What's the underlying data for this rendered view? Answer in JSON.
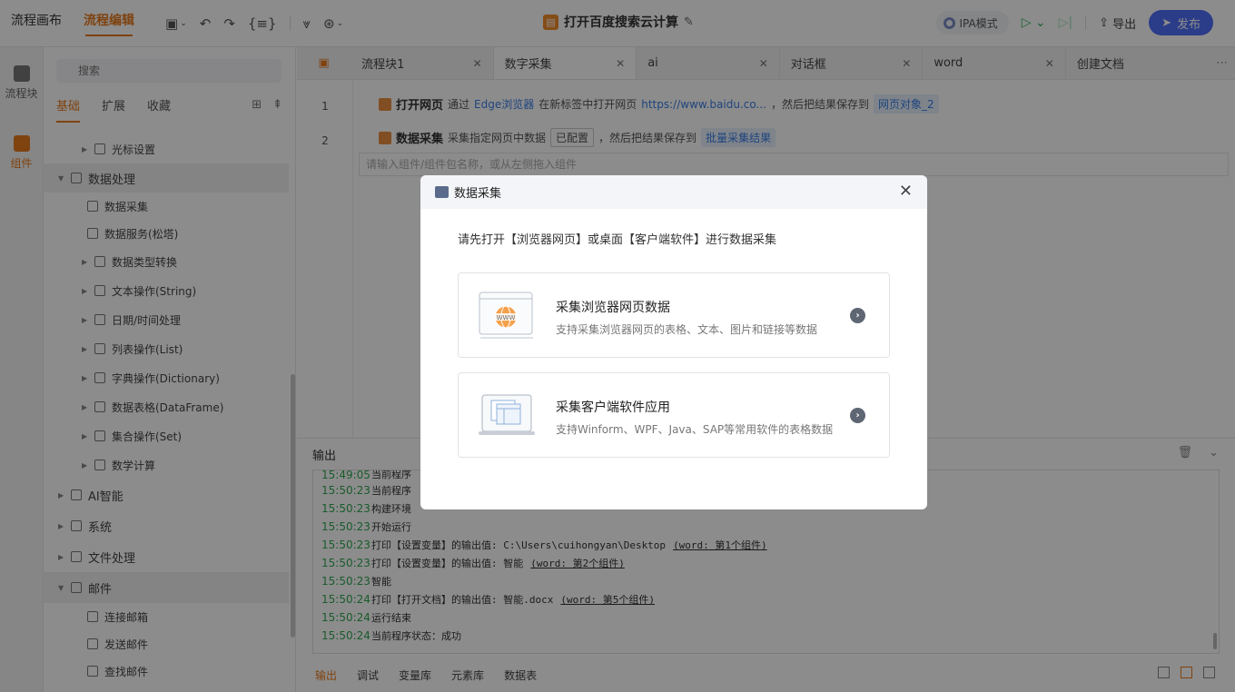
{
  "topbar": {
    "tabs": [
      "流程画布",
      "流程编辑"
    ],
    "title": "打开百度搜索云计算",
    "mode": "IPA模式",
    "export": "导出",
    "publish": "发布",
    "icons": [
      "save-icon",
      "undo-icon",
      "redo-icon",
      "variable-icon",
      "collect-icon",
      "ai-icon"
    ]
  },
  "rail": {
    "items": [
      "流程块",
      "组件"
    ]
  },
  "panel": {
    "search_placeholder": "搜索",
    "tabs": [
      "基础",
      "扩展",
      "收藏"
    ],
    "tree": [
      "光标设置",
      "数据处理",
      "数据采集",
      "数据服务(松塔)",
      "数据类型转换",
      "文本操作(String)",
      "日期/时间处理",
      "列表操作(List)",
      "字典操作(Dictionary)",
      "数据表格(DataFrame)",
      "集合操作(Set)",
      "数学计算",
      "AI智能",
      "系统",
      "文件处理",
      "邮件",
      "连接邮箱",
      "发送邮件",
      "查找邮件"
    ]
  },
  "editor": {
    "tabs": [
      "流程块1",
      "数字采集",
      "ai",
      "对话框",
      "word",
      "创建文档"
    ],
    "lines": [
      {
        "num": "1",
        "cmd": "打开网页",
        "p1": "通过",
        "link1": "Edge浏览器",
        "p2": "在新标签中打开网页",
        "link2": "https://www.baidu.co...",
        "p3": "，然后把结果保存到",
        "chip": "网页对象_2"
      },
      {
        "num": "2",
        "cmd": "数据采集",
        "p1": "采集指定网页中数据",
        "tag": "已配置",
        "p2": "，然后把结果保存到",
        "chip": "批量采集结果"
      }
    ],
    "input_placeholder": "请输入组件/组件包名称，或从左侧拖入组件"
  },
  "output": {
    "title": "输出",
    "logs": [
      {
        "t": "15:49:05",
        "m": "当前程序",
        "u": ""
      },
      {
        "t": "15:50:23",
        "m": "当前程序",
        "u": ""
      },
      {
        "t": "15:50:23",
        "m": "构建环境",
        "u": ""
      },
      {
        "t": "15:50:23",
        "m": "开始运行",
        "u": ""
      },
      {
        "t": "15:50:23",
        "m": "打印【设置变量】的输出值: C:\\Users\\cuihongyan\\Desktop",
        "u": "(word: 第1个组件)"
      },
      {
        "t": "15:50:23",
        "m": "打印【设置变量】的输出值: 智能",
        "u": "(word: 第2个组件)"
      },
      {
        "t": "15:50:23",
        "m": "智能",
        "u": ""
      },
      {
        "t": "15:50:24",
        "m": "打印【打开文档】的输出值: 智能.docx",
        "u": "(word: 第5个组件)"
      },
      {
        "t": "15:50:24",
        "m": "运行结束",
        "u": ""
      },
      {
        "t": "15:50:24",
        "m": "当前程序状态：成功",
        "u": ""
      }
    ],
    "bottom_tabs": [
      "输出",
      "调试",
      "变量库",
      "元素库",
      "数据表"
    ]
  },
  "dialog": {
    "title": "数据采集",
    "desc": "请先打开【浏览器网页】或桌面【客户端软件】进行数据采集",
    "cards": [
      {
        "title": "采集浏览器网页数据",
        "sub": "支持采集浏览器网页的表格、文本、图片和链接等数据"
      },
      {
        "title": "采集客户端软件应用",
        "sub": "支持Winform、WPF、Java、SAP等常用软件的表格数据"
      }
    ]
  },
  "colors": {
    "accent": "#e87a1e",
    "primary": "#4f6ef7",
    "link": "#3a7ee5",
    "time": "#2fa650"
  }
}
